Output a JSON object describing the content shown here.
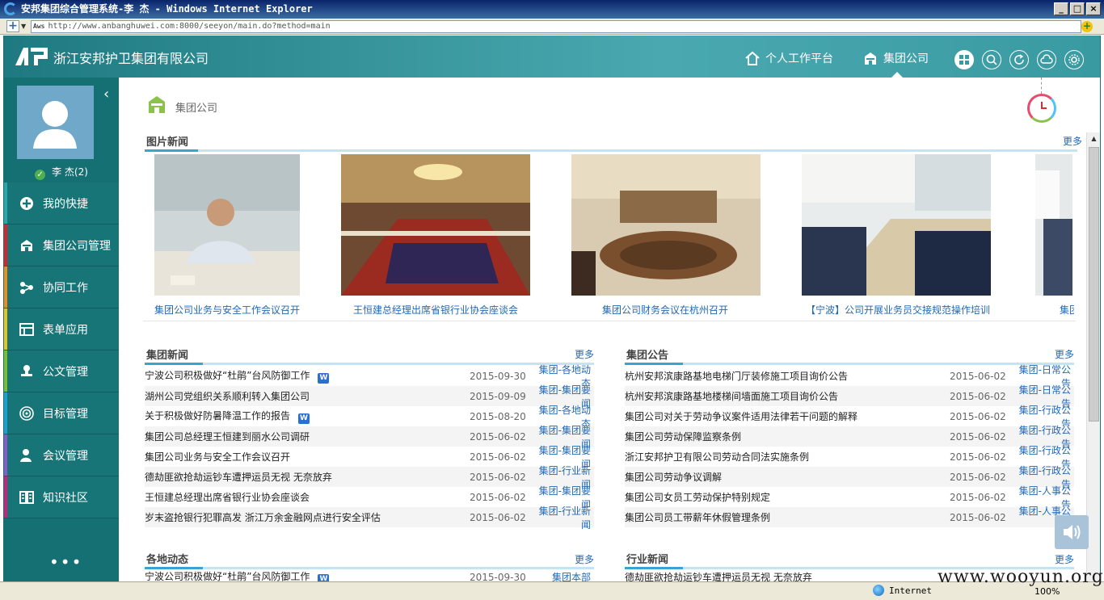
{
  "window": {
    "title": "安邦集团综合管理系统-李 杰 - Windows Internet Explorer",
    "minimize": "_",
    "maximize": "□",
    "close": "×"
  },
  "address": {
    "tag": "Aws",
    "url": "http://www.anbanghuwei.com:8000/seeyon/main.do?method=main"
  },
  "header": {
    "company": "浙江安邦护卫集团有限公司",
    "nav_personal": "个人工作平台",
    "nav_group": "集团公司"
  },
  "sidebar": {
    "user": "李 杰(2)",
    "more": "•••",
    "items": [
      {
        "label": "我的快捷",
        "color": "#2aa6a8"
      },
      {
        "label": "集团公司管理",
        "color": "#d9242b"
      },
      {
        "label": "协同工作",
        "color": "#f08c1a"
      },
      {
        "label": "表单应用",
        "color": "#e9c21a"
      },
      {
        "label": "公文管理",
        "color": "#7bbd2a"
      },
      {
        "label": "目标管理",
        "color": "#1f9fd0"
      },
      {
        "label": "会议管理",
        "color": "#8a5bc7"
      },
      {
        "label": "知识社区",
        "color": "#c8237e"
      }
    ]
  },
  "content": {
    "breadcrumb": "集团公司",
    "photo_news": {
      "title": "图片新闻",
      "more": "更多",
      "items": [
        {
          "caption": "集团公司业务与安全工作会议召开"
        },
        {
          "caption": "王恒建总经理出席省银行业协会座谈会"
        },
        {
          "caption": "集团公司财务会议在杭州召开"
        },
        {
          "caption": "【宁波】公司开展业务员交接规范操作培训"
        },
        {
          "caption": "集团"
        }
      ]
    },
    "group_news": {
      "title": "集团新闻",
      "more": "更多",
      "rows": [
        {
          "title": "宁波公司积极做好“杜鹃”台风防御工作",
          "doc": true,
          "date": "2015-09-30",
          "cat": "集团-各地动态"
        },
        {
          "title": "湖州公司党组织关系顺利转入集团公司",
          "doc": false,
          "date": "2015-09-09",
          "cat": "集团-集团要闻"
        },
        {
          "title": "关于积极做好防暑降温工作的报告",
          "doc": true,
          "date": "2015-08-20",
          "cat": "集团-各地动态"
        },
        {
          "title": "集团公司总经理王恒建到丽水公司调研",
          "doc": false,
          "date": "2015-06-02",
          "cat": "集团-集团要闻"
        },
        {
          "title": "集团公司业务与安全工作会议召开",
          "doc": false,
          "date": "2015-06-02",
          "cat": "集团-集团要闻"
        },
        {
          "title": "德劫匪欲抢劫运钞车遭押运员无视 无奈放弃",
          "doc": false,
          "date": "2015-06-02",
          "cat": "集团-行业新闻"
        },
        {
          "title": "王恒建总经理出席省银行业协会座谈会",
          "doc": false,
          "date": "2015-06-02",
          "cat": "集团-集团要闻"
        },
        {
          "title": "岁末盗抢银行犯罪高发 浙江万余金融网点进行安全评估",
          "doc": false,
          "date": "2015-06-02",
          "cat": "集团-行业新闻"
        }
      ]
    },
    "group_notice": {
      "title": "集团公告",
      "more": "更多",
      "rows": [
        {
          "title": "杭州安邦滨康路基地电梯门厅装修施工项目询价公告",
          "date": "2015-06-02",
          "cat": "集团-日常公告"
        },
        {
          "title": "杭州安邦滨康路基地楼梯间墙面施工项目询价公告",
          "date": "2015-06-02",
          "cat": "集团-日常公告"
        },
        {
          "title": "集团公司对关于劳动争议案件适用法律若干问题的解释",
          "date": "2015-06-02",
          "cat": "集团-行政公告"
        },
        {
          "title": "集团公司劳动保障监察条例",
          "date": "2015-06-02",
          "cat": "集团-行政公告"
        },
        {
          "title": "浙江安邦护卫有限公司劳动合同法实施条例",
          "date": "2015-06-02",
          "cat": "集团-行政公告"
        },
        {
          "title": "集团公司劳动争议调解",
          "date": "2015-06-02",
          "cat": "集团-行政公告"
        },
        {
          "title": "集团公司女员工劳动保护特别规定",
          "date": "2015-06-02",
          "cat": "集团-人事公告"
        },
        {
          "title": "集团公司员工带薪年休假管理条例",
          "date": "2015-06-02",
          "cat": "集团-人事公告"
        }
      ]
    },
    "local_news": {
      "title": "各地动态",
      "more": "更多",
      "partial_row": "宁波公司积极做好“杜鹃”台风防御工作",
      "partial_date": "2015-09-30",
      "partial_cat": "集团本部"
    },
    "industry_news": {
      "title": "行业新闻",
      "more": "更多",
      "partial_row": "德劫匪欲抢劫运钞车遭押运员无视 无奈放弃"
    }
  },
  "doc_icon_label": "W",
  "statusbar": {
    "zone": "Internet",
    "zoom": "100%"
  },
  "watermark": "www.wooyun.org"
}
